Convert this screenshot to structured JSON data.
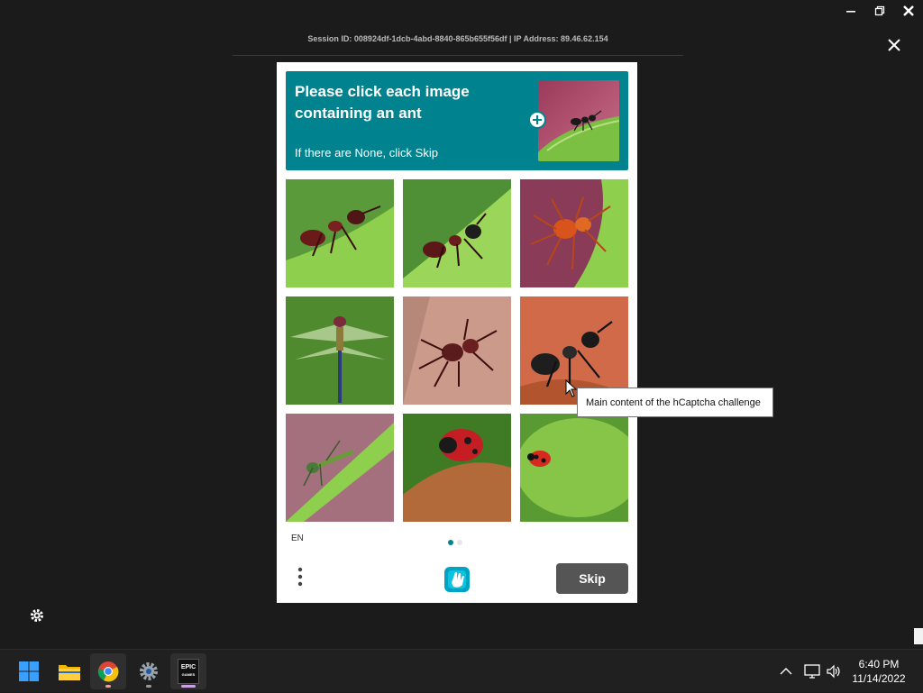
{
  "window_controls": {
    "minimize": "minimize",
    "restore": "restore",
    "close": "close"
  },
  "session": {
    "text": "Session ID: 008924df-1dcb-4abd-8840-865b655f56df | IP Address: 89.46.62.154"
  },
  "captcha": {
    "prompt_title": "Please click each image containing an ant",
    "prompt_sub": "If there are None, click Skip",
    "example_alt": "ant on leaf",
    "tiles": [
      {
        "subject": "ant"
      },
      {
        "subject": "ant"
      },
      {
        "subject": "spider"
      },
      {
        "subject": "dragonfly"
      },
      {
        "subject": "spider"
      },
      {
        "subject": "ant"
      },
      {
        "subject": "insect"
      },
      {
        "subject": "ladybug"
      },
      {
        "subject": "ladybug"
      }
    ],
    "language": "EN",
    "skip_label": "Skip",
    "accent": "#00838f"
  },
  "tooltip": {
    "text": "Main content of the hCaptcha challenge"
  },
  "taskbar": {
    "apps": [
      "windows-start",
      "file-explorer",
      "chrome",
      "settings",
      "epic-games"
    ],
    "epic_label_1": "EPIC",
    "epic_label_2": "GAMES",
    "time": "6:40 PM",
    "date": "11/14/2022"
  }
}
